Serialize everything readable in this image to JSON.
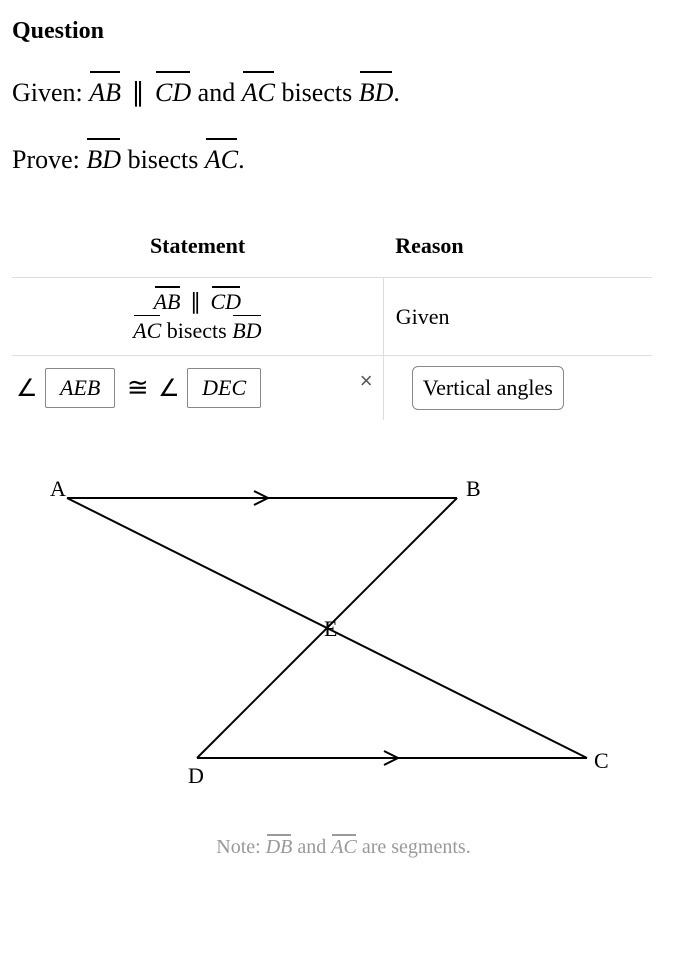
{
  "heading": "Question",
  "given_prefix": "Given: ",
  "seg_ab": "AB",
  "parallel_sym": "∥",
  "seg_cd": "CD",
  "given_and": " and ",
  "seg_ac": "AC",
  "given_bisects": " bisects ",
  "seg_bd": "BD",
  "period": ".",
  "prove_prefix": "Prove: ",
  "table": {
    "header_statement": "Statement",
    "header_reason": "Reason",
    "row1_given": "Given",
    "angle_sym": "∠",
    "input1": "AEB",
    "congruent_sym": "≅",
    "input2": "DEC",
    "x_sym": "×",
    "reason_input": "Vertical angles"
  },
  "diagram": {
    "label_a": "A",
    "label_b": "B",
    "label_c": "C",
    "label_d": "D",
    "label_e": "E"
  },
  "note_prefix": "Note: ",
  "note_db": "DB",
  "note_and": " and ",
  "note_ac": "AC",
  "note_suffix": " are segments."
}
